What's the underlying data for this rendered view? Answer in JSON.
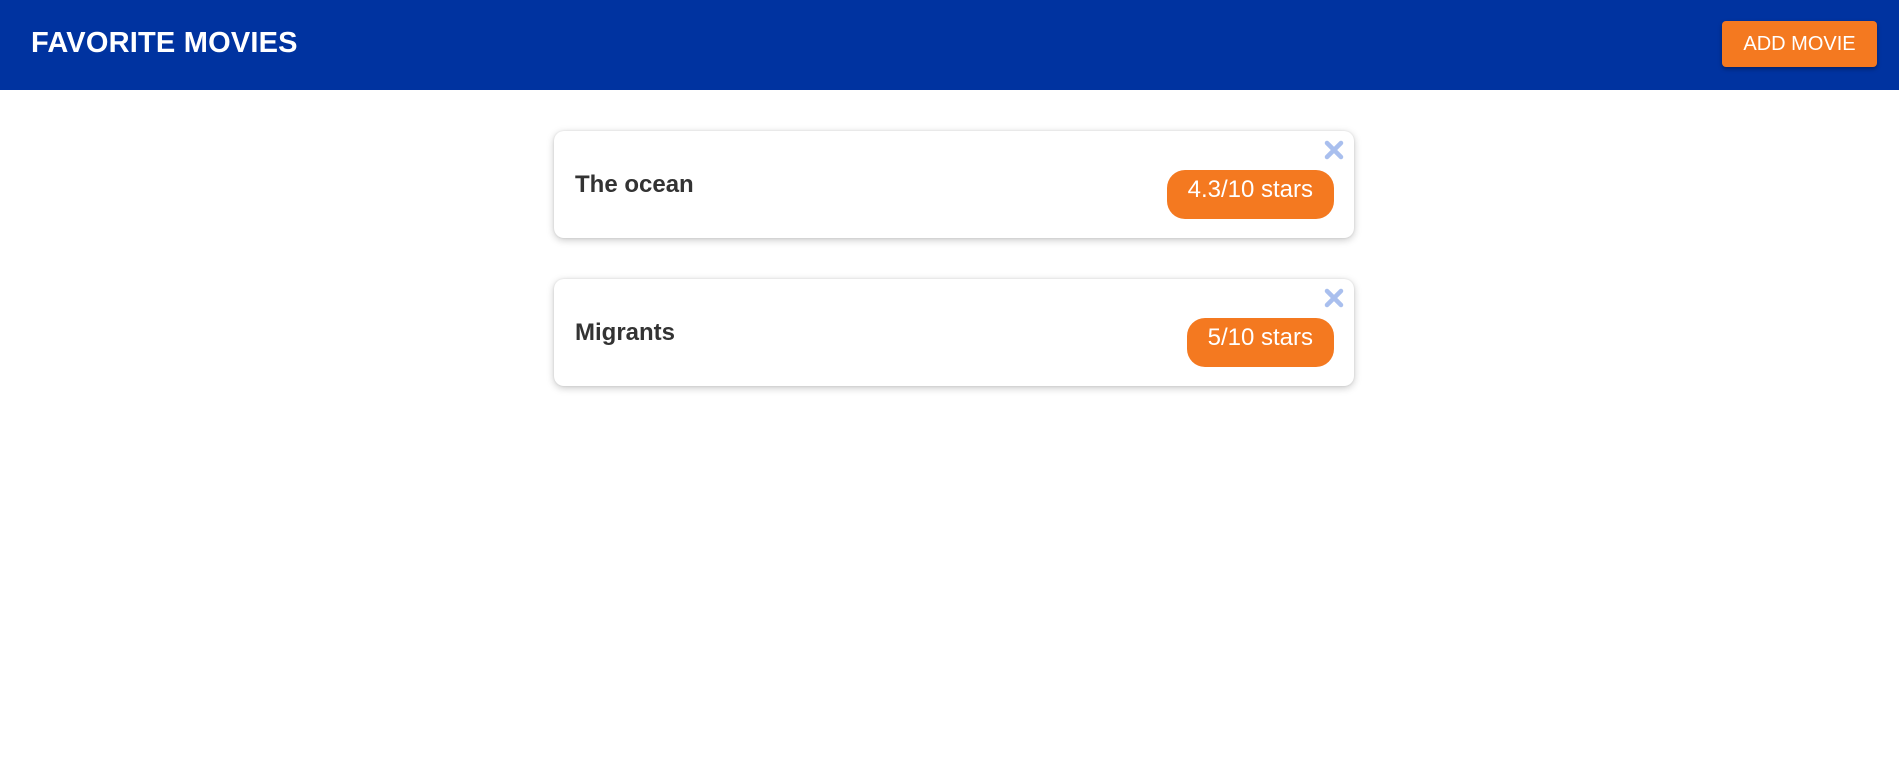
{
  "header": {
    "title": "FAVORITE MOVIES",
    "add_button_label": "ADD MOVIE",
    "background_color": "#0033a0",
    "accent_color": "#f47920"
  },
  "movies": [
    {
      "title": "The ocean",
      "rating_label": "4.3/10 stars",
      "remove_icon": "close-icon"
    },
    {
      "title": "Migrants",
      "rating_label": "5/10 stars",
      "remove_icon": "close-icon"
    }
  ]
}
